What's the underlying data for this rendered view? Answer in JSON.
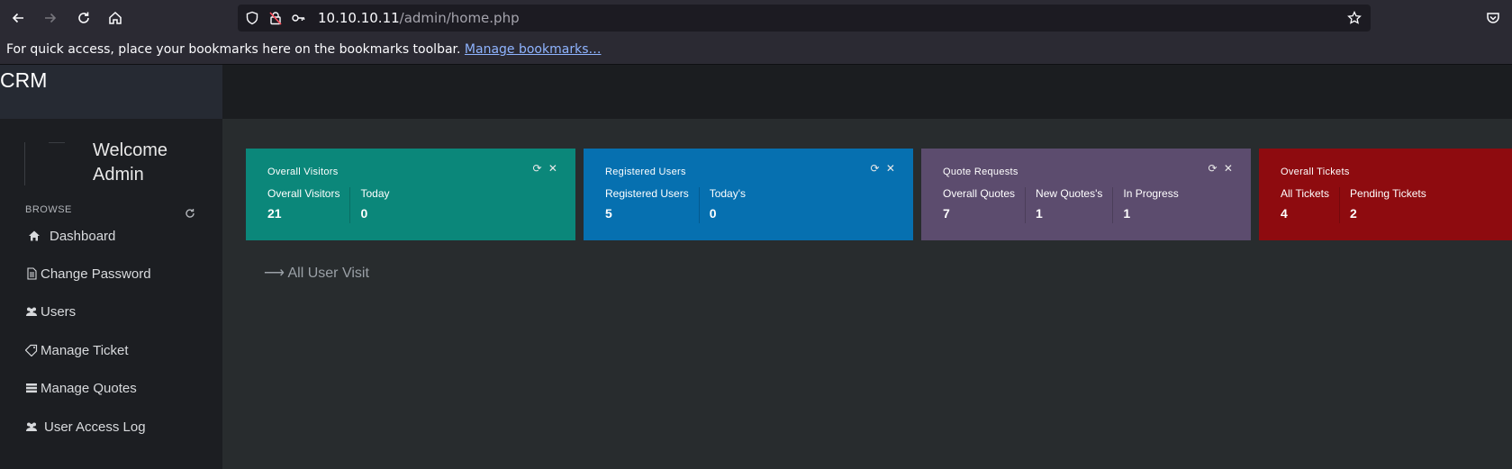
{
  "browser": {
    "url_host": "10.10.10.11",
    "url_path": "/admin/home.php",
    "bookmarks_text": "For quick access, place your bookmarks here on the bookmarks toolbar.",
    "bookmarks_link": "Manage bookmarks…"
  },
  "app": {
    "brand": "CRM",
    "welcome_line1": "Welcome",
    "welcome_line2": "Admin",
    "browse_label": "BROWSE",
    "menu": [
      {
        "label": "Dashboard",
        "icon": "home-icon"
      },
      {
        "label": "Change Password",
        "icon": "document-icon"
      },
      {
        "label": "Users",
        "icon": "users-icon"
      },
      {
        "label": "Manage Ticket",
        "icon": "ticket-icon"
      },
      {
        "label": "Manage Quotes",
        "icon": "list-icon"
      },
      {
        "label": "User Access Log",
        "icon": "users-icon"
      }
    ]
  },
  "cards": [
    {
      "title": "Overall Visitors",
      "color": "#0b877a",
      "stats": [
        {
          "label": "Overall Visitors",
          "value": "21"
        },
        {
          "label": "Today",
          "value": "0"
        }
      ]
    },
    {
      "title": "Registered Users",
      "color": "#0670b0",
      "stats": [
        {
          "label": "Registered Users",
          "value": "5"
        },
        {
          "label": "Today's",
          "value": "0"
        }
      ]
    },
    {
      "title": "Quote Requests",
      "color": "#5c4c6e",
      "stats": [
        {
          "label": "Overall Quotes",
          "value": "7"
        },
        {
          "label": "New Quotes's",
          "value": "1"
        },
        {
          "label": "In Progress",
          "value": "1"
        }
      ]
    },
    {
      "title": "Overall Tickets",
      "color": "#8e0b0f",
      "stats": [
        {
          "label": "All Tickets",
          "value": "4"
        },
        {
          "label": "Pending Tickets",
          "value": "2"
        }
      ]
    }
  ],
  "card_tools": "⟳ ✕",
  "visit_link": "⟶ All User Visit"
}
